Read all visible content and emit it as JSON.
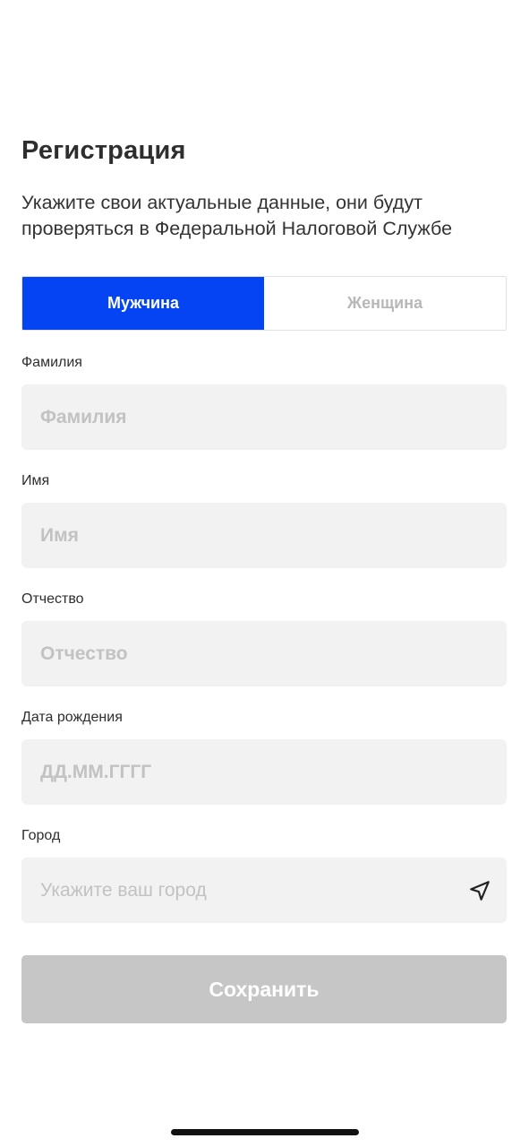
{
  "header": {
    "title": "Регистрация",
    "subtitle": "Укажите свои актуальные данные, они будут проверяться в Федеральной Налоговой Службе"
  },
  "gender": {
    "options": [
      {
        "label": "Мужчина",
        "selected": true
      },
      {
        "label": "Женщина",
        "selected": false
      }
    ],
    "active_color": "#0444f2"
  },
  "form": {
    "last_name": {
      "label": "Фамилия",
      "placeholder": "Фамилия",
      "value": ""
    },
    "first_name": {
      "label": "Имя",
      "placeholder": "Имя",
      "value": ""
    },
    "patronymic": {
      "label": "Отчество",
      "placeholder": "Отчество",
      "value": ""
    },
    "birth_date": {
      "label": "Дата рождения",
      "placeholder": "ДД.ММ.ГГГГ",
      "value": ""
    },
    "city": {
      "label": "Город",
      "placeholder": "Укажите ваш город",
      "value": "",
      "icon": "location-arrow-icon"
    }
  },
  "actions": {
    "save_label": "Сохранить",
    "save_disabled_color": "#c6c6c6"
  }
}
